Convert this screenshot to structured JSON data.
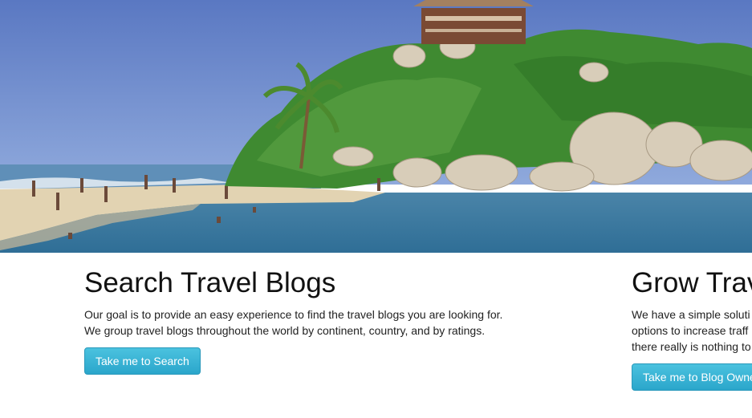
{
  "hero": {
    "image": "beach-island-photo",
    "colors": {
      "sky": "#6f8fd0",
      "sea": "#3f7fa8",
      "foliage": "#3e8a2e",
      "rock": "#d9cfbe",
      "sand": "#e6d7b8"
    }
  },
  "features": [
    {
      "title": "Search Travel Blogs",
      "lines": [
        "Our goal is to provide an easy experience to find the travel blogs you are looking for.",
        "We group travel blogs throughout the world by continent, country, and by ratings."
      ],
      "button": "Take me to Search"
    },
    {
      "title": "Grow Trav",
      "lines": [
        "We have a simple soluti",
        "options to increase traff",
        "there really is nothing to"
      ],
      "button": "Take me to Blog Owne"
    }
  ],
  "colors": {
    "button": "#2ba6cb",
    "heading": "#111111",
    "text": "#222222"
  }
}
